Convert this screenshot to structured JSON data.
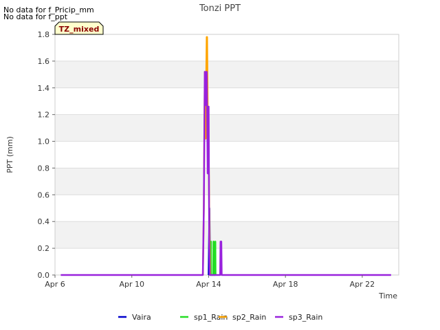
{
  "notes": [
    "No data for f_Pricip_mm",
    "No data for f_ppt"
  ],
  "badge": "TZ_mixed",
  "chart_data": {
    "type": "line",
    "title": "Tonzi PPT",
    "xlabel": "Time",
    "ylabel": "PPT (mm)",
    "ylim": [
      0,
      1.8
    ],
    "yticks": [
      0.0,
      0.2,
      0.4,
      0.6,
      0.8,
      1.0,
      1.2,
      1.4,
      1.6,
      1.8
    ],
    "ytick_labels": [
      "0.0",
      "0.2",
      "0.4",
      "0.6",
      "0.8",
      "1.0",
      "1.2",
      "1.4",
      "1.6",
      "1.8"
    ],
    "xlim": [
      6,
      23.9
    ],
    "xticks": [
      6,
      10,
      14,
      18,
      22
    ],
    "xtick_labels": [
      "Apr 6",
      "Apr 10",
      "Apr 14",
      "Apr 18",
      "Apr 22"
    ],
    "grid": true,
    "legend_position": "bottom",
    "series": [
      {
        "name": "Vaira",
        "color": "#0000cc",
        "x": [
          14.0,
          14.02,
          14.04,
          14.06,
          14.08,
          14.1,
          14.12
        ],
        "y": [
          0,
          0.25,
          0.5,
          0.25,
          0.25,
          0,
          0
        ]
      },
      {
        "name": "sp1_Rain",
        "color": "#22dd22",
        "x": [
          14.1,
          14.11,
          14.12,
          14.13,
          14.24,
          14.25,
          14.26,
          14.27,
          14.34,
          14.35,
          14.36
        ],
        "y": [
          0,
          0.25,
          0.25,
          0,
          0,
          0.25,
          0.25,
          0,
          0,
          0.25,
          0
        ]
      },
      {
        "name": "sp2_Rain",
        "color": "#ffa500",
        "x": [
          13.7,
          13.75,
          13.8,
          13.85,
          13.88,
          13.9,
          13.92,
          13.95,
          13.98,
          14.0,
          14.03,
          14.05,
          14.08
        ],
        "y": [
          0,
          0.5,
          1.52,
          1.02,
          1.55,
          1.78,
          1.78,
          1.26,
          0.76,
          1.0,
          0.5,
          0.25,
          0
        ]
      },
      {
        "name": "sp3_Rain",
        "color": "#9922dd",
        "x": [
          6.3,
          13.7,
          13.75,
          13.8,
          13.85,
          13.88,
          13.9,
          13.92,
          13.95,
          13.98,
          14.0,
          14.03,
          14.06,
          14.6,
          14.62,
          14.64,
          14.66,
          14.68,
          23.5
        ],
        "y": [
          0,
          0,
          0.5,
          1.52,
          1.27,
          1.52,
          1.52,
          1.26,
          0.76,
          0.76,
          1.26,
          0.25,
          0,
          0,
          0.25,
          0.25,
          0.25,
          0,
          0
        ]
      }
    ]
  }
}
